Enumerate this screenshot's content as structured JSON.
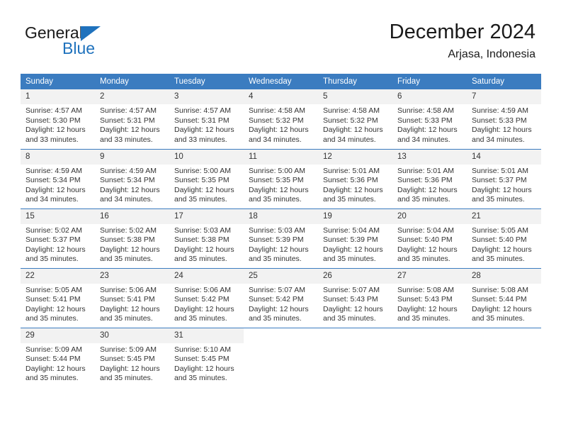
{
  "logo": {
    "text_top": "General",
    "text_bottom": "Blue",
    "flag_icon": "blue-triangle-flag-icon",
    "accent_color": "#1f72bd"
  },
  "header": {
    "month_title": "December 2024",
    "location": "Arjasa, Indonesia"
  },
  "theme": {
    "header_bg": "#3b7cc0",
    "header_text": "#ffffff",
    "daynum_bg": "#f2f2f2",
    "body_text": "#333333",
    "row_divider": "#3b7cc0"
  },
  "calendar": {
    "weekday_headers": [
      "Sunday",
      "Monday",
      "Tuesday",
      "Wednesday",
      "Thursday",
      "Friday",
      "Saturday"
    ],
    "weeks": [
      [
        {
          "day": "1",
          "sunrise": "Sunrise: 4:57 AM",
          "sunset": "Sunset: 5:30 PM",
          "daylight_line1": "Daylight: 12 hours",
          "daylight_line2": "and 33 minutes."
        },
        {
          "day": "2",
          "sunrise": "Sunrise: 4:57 AM",
          "sunset": "Sunset: 5:31 PM",
          "daylight_line1": "Daylight: 12 hours",
          "daylight_line2": "and 33 minutes."
        },
        {
          "day": "3",
          "sunrise": "Sunrise: 4:57 AM",
          "sunset": "Sunset: 5:31 PM",
          "daylight_line1": "Daylight: 12 hours",
          "daylight_line2": "and 33 minutes."
        },
        {
          "day": "4",
          "sunrise": "Sunrise: 4:58 AM",
          "sunset": "Sunset: 5:32 PM",
          "daylight_line1": "Daylight: 12 hours",
          "daylight_line2": "and 34 minutes."
        },
        {
          "day": "5",
          "sunrise": "Sunrise: 4:58 AM",
          "sunset": "Sunset: 5:32 PM",
          "daylight_line1": "Daylight: 12 hours",
          "daylight_line2": "and 34 minutes."
        },
        {
          "day": "6",
          "sunrise": "Sunrise: 4:58 AM",
          "sunset": "Sunset: 5:33 PM",
          "daylight_line1": "Daylight: 12 hours",
          "daylight_line2": "and 34 minutes."
        },
        {
          "day": "7",
          "sunrise": "Sunrise: 4:59 AM",
          "sunset": "Sunset: 5:33 PM",
          "daylight_line1": "Daylight: 12 hours",
          "daylight_line2": "and 34 minutes."
        }
      ],
      [
        {
          "day": "8",
          "sunrise": "Sunrise: 4:59 AM",
          "sunset": "Sunset: 5:34 PM",
          "daylight_line1": "Daylight: 12 hours",
          "daylight_line2": "and 34 minutes."
        },
        {
          "day": "9",
          "sunrise": "Sunrise: 4:59 AM",
          "sunset": "Sunset: 5:34 PM",
          "daylight_line1": "Daylight: 12 hours",
          "daylight_line2": "and 34 minutes."
        },
        {
          "day": "10",
          "sunrise": "Sunrise: 5:00 AM",
          "sunset": "Sunset: 5:35 PM",
          "daylight_line1": "Daylight: 12 hours",
          "daylight_line2": "and 35 minutes."
        },
        {
          "day": "11",
          "sunrise": "Sunrise: 5:00 AM",
          "sunset": "Sunset: 5:35 PM",
          "daylight_line1": "Daylight: 12 hours",
          "daylight_line2": "and 35 minutes."
        },
        {
          "day": "12",
          "sunrise": "Sunrise: 5:01 AM",
          "sunset": "Sunset: 5:36 PM",
          "daylight_line1": "Daylight: 12 hours",
          "daylight_line2": "and 35 minutes."
        },
        {
          "day": "13",
          "sunrise": "Sunrise: 5:01 AM",
          "sunset": "Sunset: 5:36 PM",
          "daylight_line1": "Daylight: 12 hours",
          "daylight_line2": "and 35 minutes."
        },
        {
          "day": "14",
          "sunrise": "Sunrise: 5:01 AM",
          "sunset": "Sunset: 5:37 PM",
          "daylight_line1": "Daylight: 12 hours",
          "daylight_line2": "and 35 minutes."
        }
      ],
      [
        {
          "day": "15",
          "sunrise": "Sunrise: 5:02 AM",
          "sunset": "Sunset: 5:37 PM",
          "daylight_line1": "Daylight: 12 hours",
          "daylight_line2": "and 35 minutes."
        },
        {
          "day": "16",
          "sunrise": "Sunrise: 5:02 AM",
          "sunset": "Sunset: 5:38 PM",
          "daylight_line1": "Daylight: 12 hours",
          "daylight_line2": "and 35 minutes."
        },
        {
          "day": "17",
          "sunrise": "Sunrise: 5:03 AM",
          "sunset": "Sunset: 5:38 PM",
          "daylight_line1": "Daylight: 12 hours",
          "daylight_line2": "and 35 minutes."
        },
        {
          "day": "18",
          "sunrise": "Sunrise: 5:03 AM",
          "sunset": "Sunset: 5:39 PM",
          "daylight_line1": "Daylight: 12 hours",
          "daylight_line2": "and 35 minutes."
        },
        {
          "day": "19",
          "sunrise": "Sunrise: 5:04 AM",
          "sunset": "Sunset: 5:39 PM",
          "daylight_line1": "Daylight: 12 hours",
          "daylight_line2": "and 35 minutes."
        },
        {
          "day": "20",
          "sunrise": "Sunrise: 5:04 AM",
          "sunset": "Sunset: 5:40 PM",
          "daylight_line1": "Daylight: 12 hours",
          "daylight_line2": "and 35 minutes."
        },
        {
          "day": "21",
          "sunrise": "Sunrise: 5:05 AM",
          "sunset": "Sunset: 5:40 PM",
          "daylight_line1": "Daylight: 12 hours",
          "daylight_line2": "and 35 minutes."
        }
      ],
      [
        {
          "day": "22",
          "sunrise": "Sunrise: 5:05 AM",
          "sunset": "Sunset: 5:41 PM",
          "daylight_line1": "Daylight: 12 hours",
          "daylight_line2": "and 35 minutes."
        },
        {
          "day": "23",
          "sunrise": "Sunrise: 5:06 AM",
          "sunset": "Sunset: 5:41 PM",
          "daylight_line1": "Daylight: 12 hours",
          "daylight_line2": "and 35 minutes."
        },
        {
          "day": "24",
          "sunrise": "Sunrise: 5:06 AM",
          "sunset": "Sunset: 5:42 PM",
          "daylight_line1": "Daylight: 12 hours",
          "daylight_line2": "and 35 minutes."
        },
        {
          "day": "25",
          "sunrise": "Sunrise: 5:07 AM",
          "sunset": "Sunset: 5:42 PM",
          "daylight_line1": "Daylight: 12 hours",
          "daylight_line2": "and 35 minutes."
        },
        {
          "day": "26",
          "sunrise": "Sunrise: 5:07 AM",
          "sunset": "Sunset: 5:43 PM",
          "daylight_line1": "Daylight: 12 hours",
          "daylight_line2": "and 35 minutes."
        },
        {
          "day": "27",
          "sunrise": "Sunrise: 5:08 AM",
          "sunset": "Sunset: 5:43 PM",
          "daylight_line1": "Daylight: 12 hours",
          "daylight_line2": "and 35 minutes."
        },
        {
          "day": "28",
          "sunrise": "Sunrise: 5:08 AM",
          "sunset": "Sunset: 5:44 PM",
          "daylight_line1": "Daylight: 12 hours",
          "daylight_line2": "and 35 minutes."
        }
      ],
      [
        {
          "day": "29",
          "sunrise": "Sunrise: 5:09 AM",
          "sunset": "Sunset: 5:44 PM",
          "daylight_line1": "Daylight: 12 hours",
          "daylight_line2": "and 35 minutes."
        },
        {
          "day": "30",
          "sunrise": "Sunrise: 5:09 AM",
          "sunset": "Sunset: 5:45 PM",
          "daylight_line1": "Daylight: 12 hours",
          "daylight_line2": "and 35 minutes."
        },
        {
          "day": "31",
          "sunrise": "Sunrise: 5:10 AM",
          "sunset": "Sunset: 5:45 PM",
          "daylight_line1": "Daylight: 12 hours",
          "daylight_line2": "and 35 minutes."
        },
        {
          "day": "",
          "sunrise": "",
          "sunset": "",
          "daylight_line1": "",
          "daylight_line2": ""
        },
        {
          "day": "",
          "sunrise": "",
          "sunset": "",
          "daylight_line1": "",
          "daylight_line2": ""
        },
        {
          "day": "",
          "sunrise": "",
          "sunset": "",
          "daylight_line1": "",
          "daylight_line2": ""
        },
        {
          "day": "",
          "sunrise": "",
          "sunset": "",
          "daylight_line1": "",
          "daylight_line2": ""
        }
      ]
    ]
  }
}
